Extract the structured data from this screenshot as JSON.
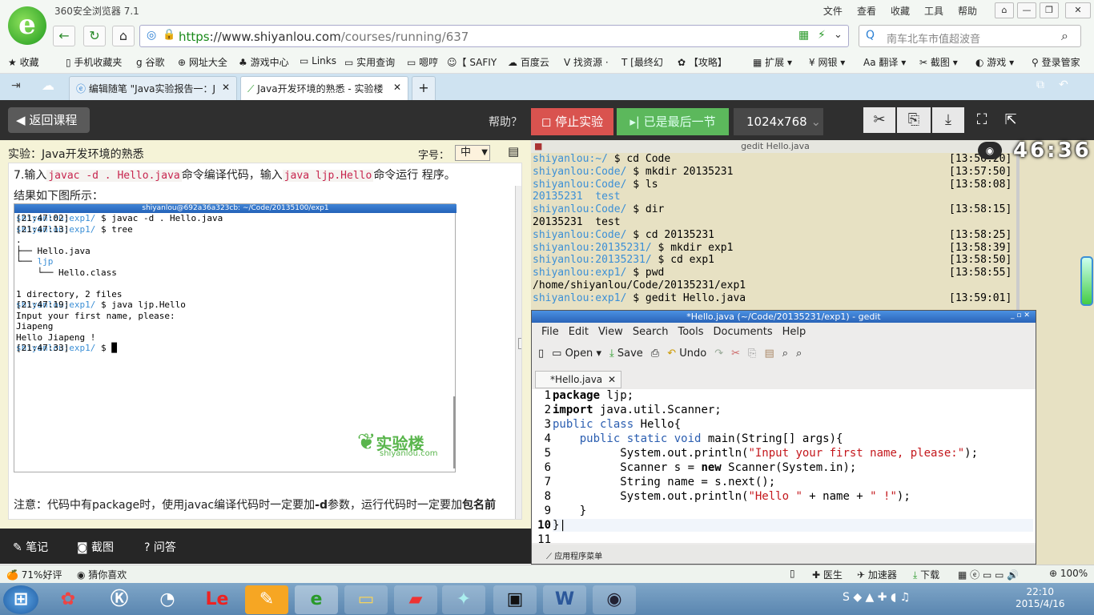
{
  "browser": {
    "app_title": "360安全浏览器 7.1",
    "menu": [
      "文件",
      "查看",
      "收藏",
      "工具",
      "帮助"
    ],
    "url_scheme": "https",
    "url_host": "://www.shiyanlou.com",
    "url_path": "/courses/running/637",
    "search_placeholder": "南车北车市值超波音",
    "bookmarks": [
      "收藏",
      "手机收藏夹",
      "谷歌",
      "网址大全",
      "游戏中心",
      "Links",
      "实用查询",
      "嗯哼",
      "【 SAFIY",
      "百度云",
      "找资源 ·",
      "[最终幻",
      "【攻略】",
      "扩展",
      "网银",
      "翻译",
      "截图",
      "游戏",
      "登录管家"
    ],
    "tabs": [
      {
        "title": "编辑随笔 \"Java实验报告一：J"
      },
      {
        "title": "Java开发环境的熟悉 - 实验楼"
      }
    ]
  },
  "page": {
    "back_label": "返回课程",
    "help_label": "帮助？",
    "stop_label": "停止实验",
    "last_label": "已是最后一节",
    "resolution": "1024x768",
    "experiment_title": "实验：Java开发环境的熟悉",
    "font_label": "字号：",
    "font_value": "中",
    "step7": {
      "prefix": "7.输入",
      "cmd1": "javac -d . Hello.java",
      "mid": "命令编译代码，输入",
      "cmd2": "java ljp.Hello",
      "suffix": "命令运行 程序。"
    },
    "result_text": "结果如下图所示：",
    "note_text": "注意：代码中有package时，使用javac编译代码时一定要加",
    "note_flag": "-d",
    "note_text2": "参数，运行代码时一定要加",
    "note_bold2": "包名前缀",
    "note_end": "。",
    "watermark": "实验楼",
    "watermark_sub": "shiyanlou.com",
    "tools": [
      "笔记",
      "截图",
      "问答"
    ]
  },
  "term1": {
    "title": "shiyanlou@692a36a323cb: ~/Code/20135100/exp1",
    "lines": [
      {
        "p": "shiyanlou",
        "d": ":exp1/",
        "c": " $ javac -d . Hello.java",
        "t": "[21:47:02]"
      },
      {
        "p": "shiyanlou",
        "d": ":exp1/",
        "c": " $ tree",
        "t": "[21:47:13]"
      },
      {
        "c": "."
      },
      {
        "c": "├── Hello.java"
      },
      {
        "c": "└── ljp"
      },
      {
        "c": "    └── Hello.class"
      },
      {
        "c": ""
      },
      {
        "c": "1 directory, 2 files"
      },
      {
        "p": "shiyanlou",
        "d": ":exp1/",
        "c": " $ java ljp.Hello",
        "t": "[21:47:19]"
      },
      {
        "c": "Input your first name, please:"
      },
      {
        "c": "Jiapeng"
      },
      {
        "c": "Hello Jiapeng !"
      },
      {
        "p": "shiyanlou",
        "d": ":exp1/",
        "c": " $ █",
        "t": "[21:47:33]"
      }
    ]
  },
  "vm": {
    "window_title": "gedit Hello.java",
    "timer": "46:36",
    "terminal": [
      {
        "p": "shiyanlou",
        "d": ":~/",
        "c": " $ cd Code",
        "t": "[13:56:20]"
      },
      {
        "p": "shiyanlou",
        "d": ":Code/",
        "c": " $ mkdir 20135231",
        "t": "[13:57:50]"
      },
      {
        "p": "shiyanlou",
        "d": ":Code/",
        "c": " $ ls",
        "t": "[13:58:08]"
      },
      {
        "blue": "20135231  test"
      },
      {
        "p": "shiyanlou",
        "d": ":Code/",
        "c": " $ dir",
        "t": "[13:58:15]"
      },
      {
        "c": "20135231  test"
      },
      {
        "p": "shiyanlou",
        "d": ":Code/",
        "c": " $ cd 20135231",
        "t": "[13:58:25]"
      },
      {
        "p": "shiyanlou",
        "d": ":20135231/",
        "c": " $ mkdir exp1",
        "t": "[13:58:39]"
      },
      {
        "p": "shiyanlou",
        "d": ":20135231/",
        "c": " $ cd exp1",
        "t": "[13:58:50]"
      },
      {
        "p": "shiyanlou",
        "d": ":exp1/",
        "c": " $ pwd",
        "t": "[13:58:55]"
      },
      {
        "c": "/home/shiyanlou/Code/20135231/exp1"
      },
      {
        "p": "shiyanlou",
        "d": ":exp1/",
        "c": " $ gedit Hello.java",
        "t": "[13:59:01]"
      }
    ],
    "gedit": {
      "title": "*Hello.java (~/Code/20135231/exp1) - gedit",
      "menu": [
        "File",
        "Edit",
        "View",
        "Search",
        "Tools",
        "Documents",
        "Help"
      ],
      "open": "Open",
      "save": "Save",
      "undo": "Undo",
      "tab": "*Hello.java",
      "status": "应用程序菜单"
    }
  },
  "statusbar": {
    "rating": "71%好评",
    "guess": "猜你喜欢",
    "doctor": "医生",
    "accel": "加速器",
    "download": "下载",
    "zoom": "100%"
  },
  "taskbar": {
    "time": "22:10",
    "date": "2015/4/16"
  }
}
